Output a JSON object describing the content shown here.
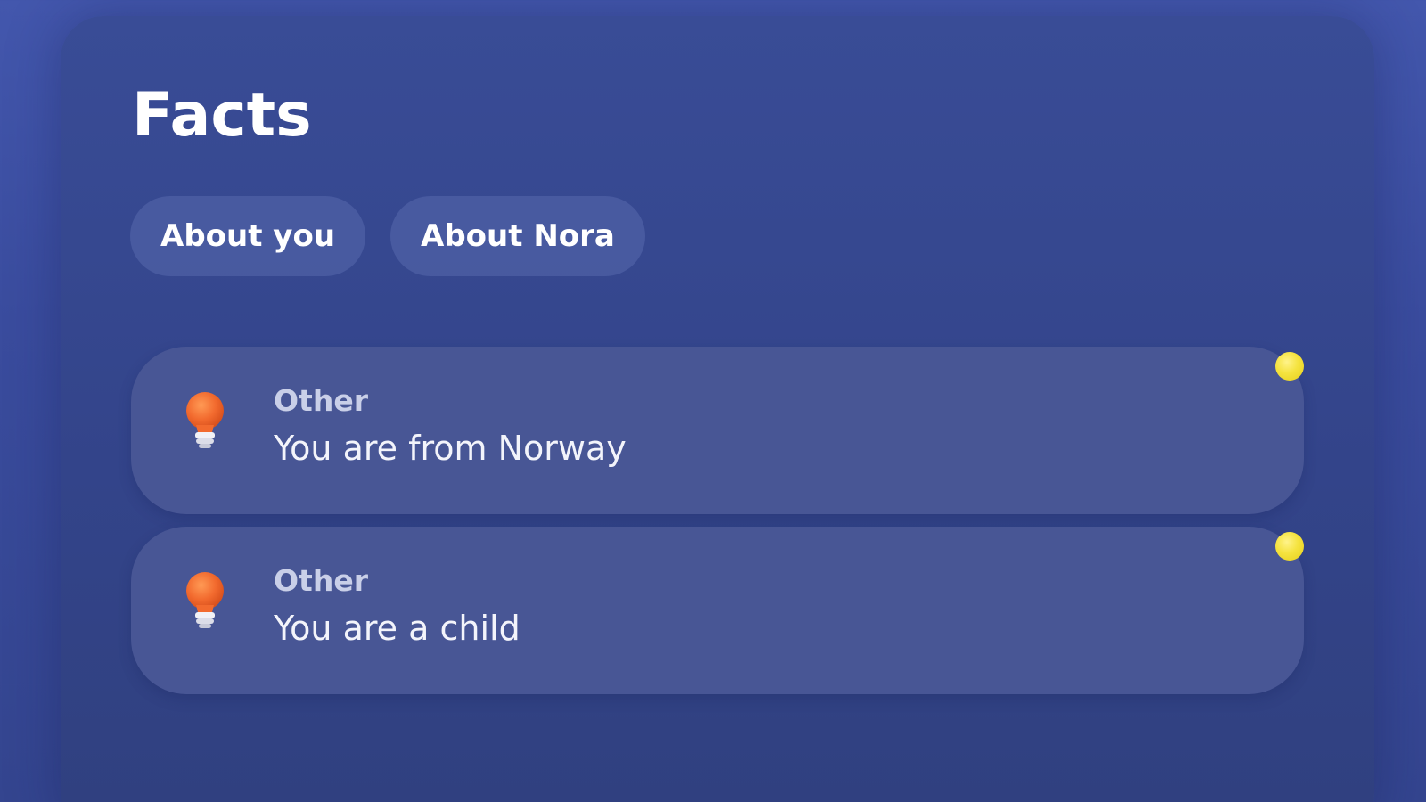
{
  "header": {
    "title": "Facts"
  },
  "tabs": [
    {
      "label": "About you"
    },
    {
      "label": "About Nora"
    }
  ],
  "facts": [
    {
      "category": "Other",
      "text": "You are from Norway",
      "icon": "lightbulb-icon",
      "unread": true
    },
    {
      "category": "Other",
      "text": "You are a child",
      "icon": "lightbulb-icon",
      "unread": true
    }
  ],
  "colors": {
    "background": "#4357ad",
    "panel": "#394c96",
    "card": "#485695",
    "bulb": "#f26a2e",
    "indicator": "#f5e33f"
  }
}
